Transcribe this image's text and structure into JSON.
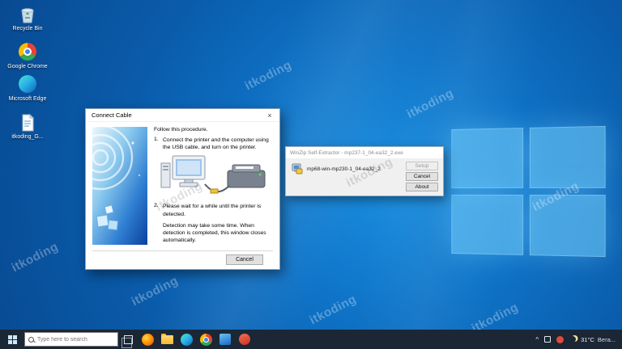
{
  "desktop": {
    "watermark": "itkoding",
    "icons": {
      "recycle_bin": "Recycle Bin",
      "chrome": "Google Chrome",
      "edge": "Microsoft Edge",
      "file": "itkoding_G..."
    }
  },
  "connect_cable": {
    "title": "Connect Cable",
    "close_glyph": "×",
    "intro": "Follow this procedure.",
    "steps": [
      {
        "num": "1.",
        "text": "Connect the printer and the computer using the USB cable, and turn on the printer."
      },
      {
        "num": "2.",
        "text": "Please wait for a while until the printer is detected."
      }
    ],
    "note": "Detection may take some time. When detection is completed, this window closes automatically.",
    "cancel_label": "Cancel"
  },
  "winzip": {
    "title": "WinZip Self-Extractor - mp237-1_04-ea32_2.exe",
    "filename": "mp68-win-mp230-1_04-ea32_2",
    "setup_label": "Setup",
    "cancel_label": "Cancel",
    "about_label": "About"
  },
  "taskbar": {
    "search_placeholder": "Type here to search",
    "tray_chevron": "^",
    "weather_temp": "31°C",
    "weather_desc": "Bera..."
  }
}
